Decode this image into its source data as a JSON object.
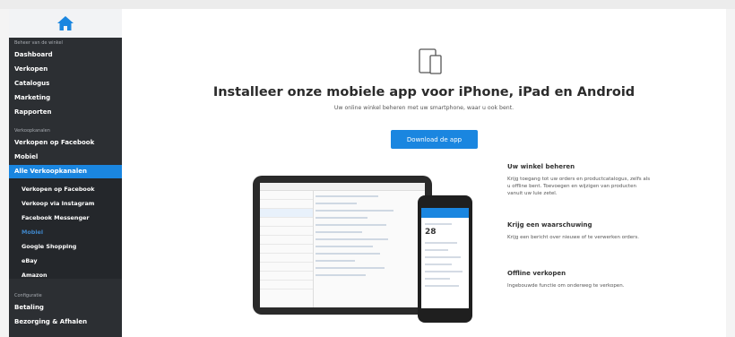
{
  "sidebar": {
    "home_icon": "home-icon",
    "section_manage": "Beheer van de winkel",
    "items_manage": [
      "Dashboard",
      "Verkopen",
      "Catalogus",
      "Marketing",
      "Rapporten"
    ],
    "section_channels": "Verkoopkanalen",
    "items_channels": [
      "Verkopen op Facebook",
      "Mobiel"
    ],
    "active_item": "Alle Verkoopkanalen",
    "sub_items": [
      "Verkopen op Facebook",
      "Verkoop via Instagram",
      "Facebook Messenger",
      "Mobiel",
      "Google Shopping",
      "eBay",
      "Amazon"
    ],
    "section_config": "Configuratie",
    "items_config": [
      "Betaling",
      "Bezorging & Afhalen"
    ]
  },
  "main": {
    "device_icon": "tablet-phone-icon",
    "title": "Installeer onze mobiele app voor iPhone, iPad en Android",
    "subtitle": "Uw online winkel beheren met uw smartphone, waar u ook bent.",
    "download_label": "Download de app",
    "phone_number": "28",
    "features": [
      {
        "title": "Uw winkel beheren",
        "text": "Krijg toegang tot uw orders en productcatalogus, zelfs als u offline bent. Toevoegen en wijzigen van producten vanuit uw luie zetel."
      },
      {
        "title": "Krijg een waarschuwing",
        "text": "Krijg een bericht over nieuwe of te verwerken orders."
      },
      {
        "title": "Offline verkopen",
        "text": "Ingebouwde functie om onderweg te verkopen."
      }
    ]
  },
  "colors": {
    "accent": "#1a86e0",
    "sidebar_bg": "#2c2f33"
  }
}
